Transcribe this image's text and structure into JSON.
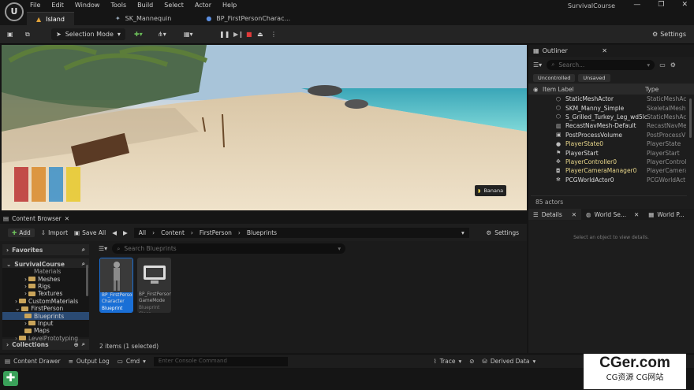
{
  "app_title": "SurvivalCourse",
  "menu": [
    "File",
    "Edit",
    "Window",
    "Tools",
    "Build",
    "Select",
    "Actor",
    "Help"
  ],
  "tabs": [
    {
      "label": "Island"
    },
    {
      "label": "SK_Mannequin"
    },
    {
      "label": "BP_FirstPersonCharac..."
    }
  ],
  "toolbar": {
    "mode": "Selection Mode",
    "settings": "Settings"
  },
  "viewport": {
    "hud_label": "Banana"
  },
  "outliner": {
    "title": "Outliner",
    "search_placeholder": "Search...",
    "chips": [
      "Uncontrolled",
      "Unsaved"
    ],
    "col_label": "Item Label",
    "col_type": "Type",
    "actor_count": "85 actors",
    "rows": [
      {
        "name": "StaticMeshActor",
        "type": "StaticMeshAct"
      },
      {
        "name": "SKM_Manny_Simple",
        "type": "SkeletalMesh"
      },
      {
        "name": "S_Grilled_Turkey_Leg_wd5lc",
        "type": "StaticMeshAc"
      },
      {
        "name": "RecastNavMesh-Default",
        "type": "RecastNavMe"
      },
      {
        "name": "PostProcessVolume",
        "type": "PostProcessV"
      },
      {
        "name": "PlayerState0",
        "type": "PlayerState"
      },
      {
        "name": "PlayerStart",
        "type": "PlayerStart"
      },
      {
        "name": "PlayerController0",
        "type": "PlayerControl"
      },
      {
        "name": "PlayerCameraManager0",
        "type": "PlayerCamera"
      },
      {
        "name": "PCGWorldActor0",
        "type": "PCGWorldAct"
      }
    ]
  },
  "details": {
    "tabs": [
      "Details",
      "World Se...",
      "World P..."
    ],
    "empty_text": "Select an object to view details."
  },
  "content_browser": {
    "title": "Content Browser",
    "add": "Add",
    "import": "Import",
    "save_all": "Save All",
    "breadcrumb": [
      "All",
      "Content",
      "FirstPerson",
      "Blueprints"
    ],
    "settings": "Settings",
    "favorites": "Favorites",
    "project": "SurvivalCourse",
    "search_placeholder": "Search Blueprints",
    "collections": "Collections",
    "status": "2 items (1 selected)",
    "tree": [
      {
        "label": "Materials",
        "indent": 2
      },
      {
        "label": "Meshes",
        "indent": 2
      },
      {
        "label": "Rigs",
        "indent": 2
      },
      {
        "label": "Textures",
        "indent": 2
      },
      {
        "label": "CustomMaterials",
        "indent": 1
      },
      {
        "label": "FirstPerson",
        "indent": 1
      },
      {
        "label": "Blueprints",
        "indent": 2,
        "selected": true
      },
      {
        "label": "Input",
        "indent": 2
      },
      {
        "label": "Maps",
        "indent": 2
      },
      {
        "label": "LevelPrototyping",
        "indent": 1
      }
    ],
    "assets": [
      {
        "name": "BP_FirstPerson Character",
        "class": "Blueprint Class",
        "selected": true
      },
      {
        "name": "BP_FirstPerson GameMode",
        "class": "Blueprint Class",
        "selected": false
      }
    ]
  },
  "statusbar": {
    "content_drawer": "Content Drawer",
    "output_log": "Output Log",
    "cmd": "Cmd",
    "console_placeholder": "Enter Console Command",
    "trace": "Trace",
    "derived_data": "Derived Data"
  },
  "watermark": {
    "line1": "CGer.com",
    "line2": "CG资源 CG网站"
  },
  "colors": {
    "accent_blue": "#1a6fd6",
    "folder": "#c9a45a",
    "selected_row": "#2a4a73"
  }
}
